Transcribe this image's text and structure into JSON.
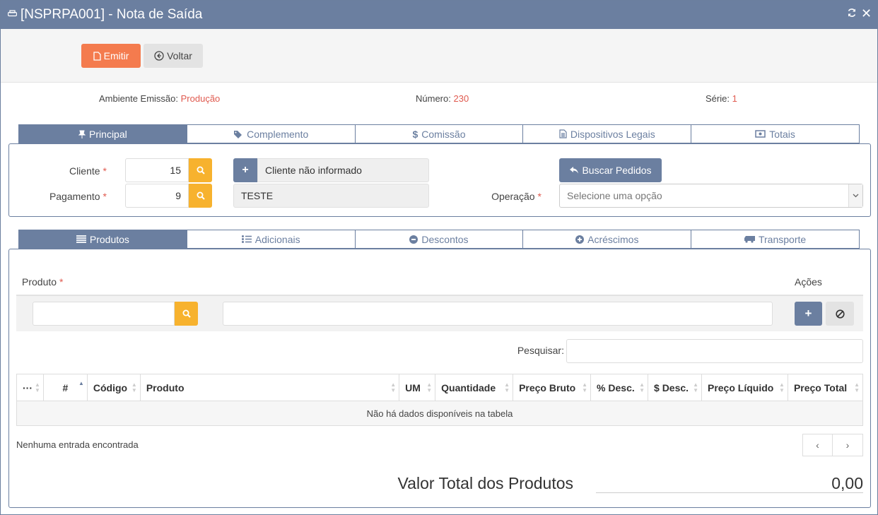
{
  "window": {
    "title": "[NSPRPA001] - Nota de Saída",
    "refresh_icon": "refresh-icon",
    "close_icon": "close-icon"
  },
  "toolbar": {
    "emit_label": "Emitir",
    "back_label": "Voltar"
  },
  "meta": {
    "ambiente_label": "Ambiente Emissão:",
    "ambiente_value": "Produção",
    "numero_label": "Número:",
    "numero_value": "230",
    "serie_label": "Série:",
    "serie_value": "1"
  },
  "tabs_top": [
    {
      "label": "Principal",
      "icon": "pin-icon",
      "active": true
    },
    {
      "label": "Complemento",
      "icon": "tags-icon",
      "active": false
    },
    {
      "label": "Comissão",
      "icon": "dollar-icon",
      "active": false
    },
    {
      "label": "Dispositivos Legais",
      "icon": "file-icon",
      "active": false
    },
    {
      "label": "Totais",
      "icon": "money-icon",
      "active": false
    }
  ],
  "form": {
    "cliente_label": "Cliente",
    "cliente_value": "15",
    "cliente_name": "Cliente não informado",
    "pagamento_label": "Pagamento",
    "pagamento_value": "9",
    "pagamento_name": "TESTE",
    "buscar_label": "Buscar Pedidos",
    "operacao_label": "Operação",
    "operacao_placeholder": "Selecione uma opção"
  },
  "tabs_bottom": [
    {
      "label": "Produtos",
      "icon": "list-icon",
      "active": true
    },
    {
      "label": "Adicionais",
      "icon": "list-ul-icon",
      "active": false
    },
    {
      "label": "Descontos",
      "icon": "minus-circle-icon",
      "active": false
    },
    {
      "label": "Acréscimos",
      "icon": "plus-circle-icon",
      "active": false
    },
    {
      "label": "Transporte",
      "icon": "truck-icon",
      "active": false
    }
  ],
  "produtos": {
    "produto_label": "Produto",
    "acoes_label": "Ações",
    "search_label": "Pesquisar:",
    "columns": [
      "···",
      "#",
      "Código",
      "Produto",
      "UM",
      "Quantidade",
      "Preço Bruto",
      "% Desc.",
      "$ Desc.",
      "Preço Líquido",
      "Preço Total"
    ],
    "empty_message": "Não há dados disponíveis na tabela",
    "info": "Nenhuma entrada encontrada",
    "prev": "‹",
    "next": "›",
    "total_label": "Valor Total dos Produtos",
    "total_value": "0,00"
  },
  "colors": {
    "primary": "#6b7fa0",
    "accent": "#f47b4e",
    "search": "#f7b22e",
    "required": "#e05a4f"
  }
}
